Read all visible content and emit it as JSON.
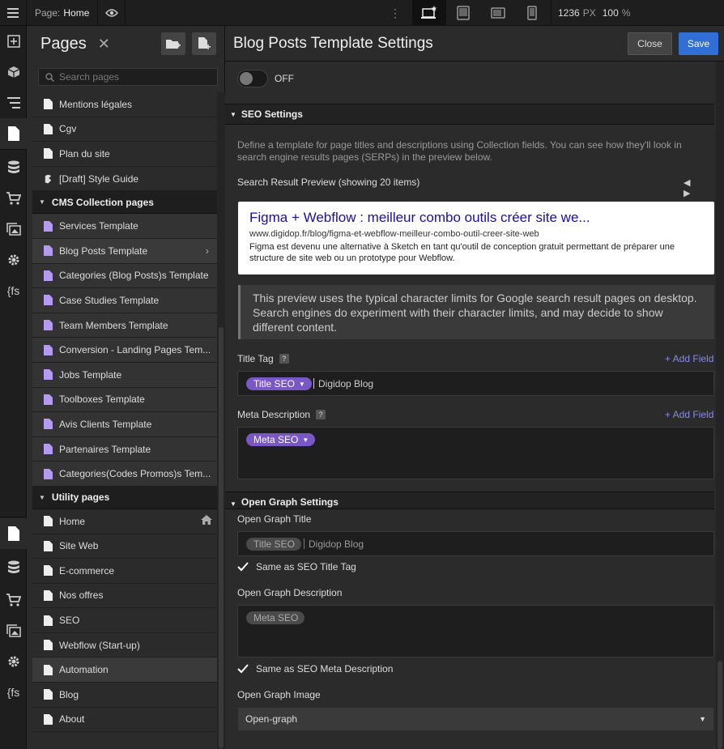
{
  "topbar": {
    "page_prefix": "Page:",
    "page_name": "Home",
    "width_value": "1236",
    "width_unit": "PX",
    "zoom_value": "100",
    "zoom_unit": "%"
  },
  "pages_panel": {
    "title": "Pages",
    "close_glyph": "✕",
    "search_placeholder": "Search pages",
    "rows_top": [
      {
        "label": "Mentions légales",
        "type": "page"
      },
      {
        "label": "Cgv",
        "type": "page"
      },
      {
        "label": "Plan du site",
        "type": "page"
      },
      {
        "label": "[Draft] Style Guide",
        "type": "draft"
      }
    ],
    "cms_folder": "CMS Collection pages",
    "cms_rows": [
      {
        "label": "Services Template"
      },
      {
        "label": "Blog Posts Template",
        "selected": true
      },
      {
        "label": "Categories (Blog Posts)s Template"
      },
      {
        "label": "Case Studies Template"
      },
      {
        "label": "Team Members Template"
      },
      {
        "label": "Conversion - Landing Pages Tem..."
      },
      {
        "label": "Jobs Template"
      },
      {
        "label": "Toolboxes Template"
      },
      {
        "label": "Avis Clients Template"
      },
      {
        "label": "Partenaires Template"
      },
      {
        "label": "Categories(Codes Promos)s Tem..."
      }
    ],
    "utility_folder": "Utility pages",
    "bottom_rows": [
      {
        "label": "Home",
        "home": true
      },
      {
        "label": "Site Web"
      },
      {
        "label": "E-commerce"
      },
      {
        "label": "Nos offres"
      },
      {
        "label": "SEO"
      },
      {
        "label": "Webflow (Start-up)"
      },
      {
        "label": "Automation",
        "hl": true
      },
      {
        "label": "Blog"
      },
      {
        "label": "About"
      }
    ]
  },
  "settings": {
    "title": "Blog Posts Template Settings",
    "close_label": "Close",
    "save_label": "Save",
    "toggle_label": "OFF",
    "seo_section": "SEO Settings",
    "seo_help": "Define a template for page titles and descriptions using Collection fields. You can see how they'll look in search engine results pages (SERPs) in the preview below.",
    "preview_label": "Search Result Preview (showing 20 items)",
    "preview_arrows": "◀ ▶",
    "preview": {
      "title": "Figma + Webflow : meilleur combo outils créer site we...",
      "url": "www.digidop.fr/blog/figma-et-webflow-meilleur-combo-outil-creer-site-web",
      "description": "Figma est devenu une alternative à Sketch en tant qu'outil de conception gratuit permettant de préparer une structure de site web ou un prototype pour Webflow."
    },
    "note": "This preview uses the typical character limits for Google search result pages on desktop. Search engines do experiment with their character limits, and may decide to show different content.",
    "title_tag_label": "Title Tag",
    "qmark": "?",
    "add_field": "+ Add Field",
    "title_tag_pill": "Title SEO",
    "title_tag_suffix": "Digidop Blog",
    "meta_desc_label": "Meta Description",
    "meta_desc_pill": "Meta SEO",
    "og_section": "Open Graph Settings",
    "og_title_label": "Open Graph Title",
    "og_title_pill": "Title SEO",
    "og_title_suffix": "Digidop Blog",
    "og_same_title": "Same as SEO Title Tag",
    "og_desc_label": "Open Graph Description",
    "og_desc_pill": "Meta SEO",
    "og_same_desc": "Same as SEO Meta Description",
    "og_image_label": "Open Graph Image",
    "og_image_value": "Open-graph"
  },
  "colors": {
    "accent_blue": "#2f6fd6",
    "pill_purple": "#7a57c7",
    "link_purple": "#8a8ae8",
    "serp_title": "#1a0dab"
  }
}
